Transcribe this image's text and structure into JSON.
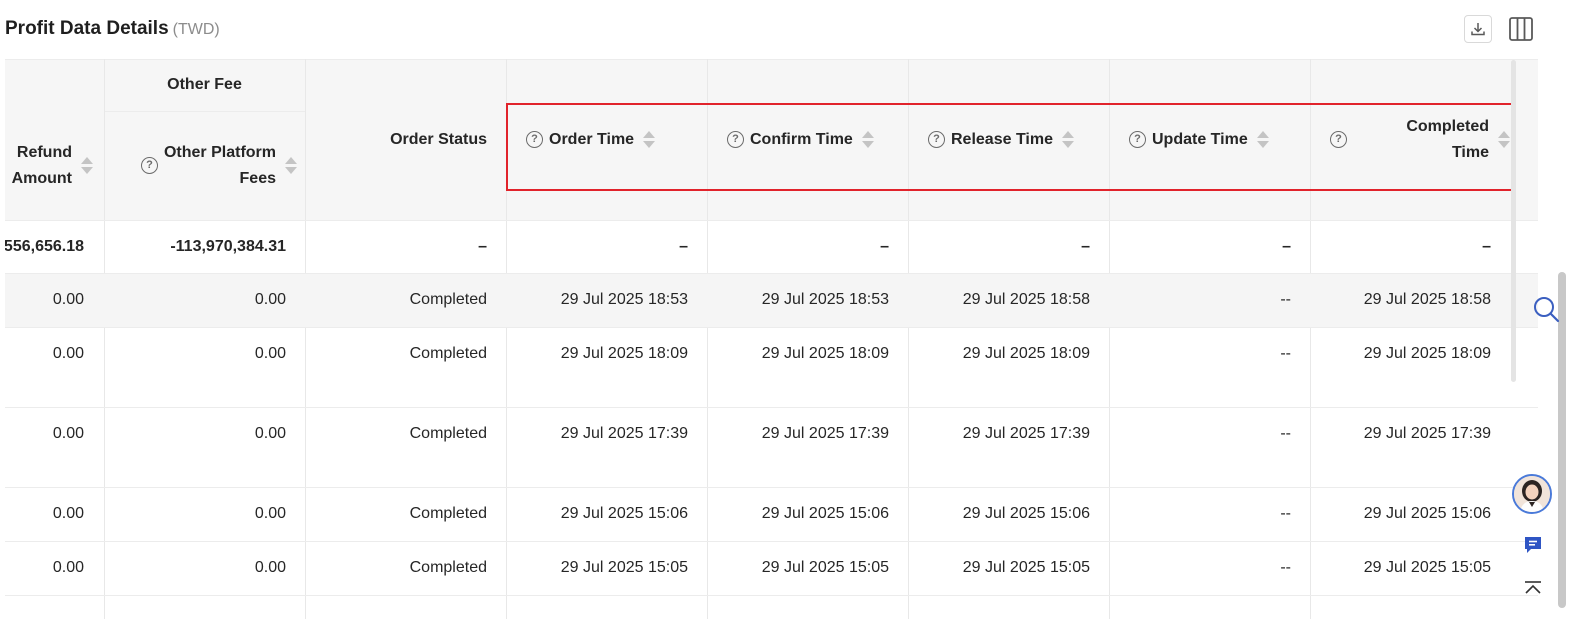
{
  "header": {
    "title": "Profit Data Details",
    "currency": "(TWD)"
  },
  "toolbar": {
    "download_icon": "download-icon",
    "columns_icon": "columns-settings-icon"
  },
  "table": {
    "group_header": "Other Fee",
    "columns": {
      "refund_amount": [
        "Refund",
        "Amount"
      ],
      "other_platform_fees": [
        "Other Platform",
        "Fees"
      ],
      "order_status": "Order Status",
      "order_time": "Order Time",
      "confirm_time": "Confirm Time",
      "release_time": "Release Time",
      "update_time": "Update Time",
      "completed_time": [
        "Completed",
        "Time"
      ]
    },
    "total_row": {
      "refund_amount": "556,656.18",
      "other_platform_fees": "-113,970,384.31",
      "order_status": "–",
      "order_time": "–",
      "confirm_time": "–",
      "release_time": "–",
      "update_time": "–",
      "completed_time": "–"
    },
    "rows": [
      {
        "refund_amount": "0.00",
        "other_platform_fees": "0.00",
        "order_status": "Completed",
        "order_time": "29 Jul 2025 18:53",
        "confirm_time": "29 Jul 2025 18:53",
        "release_time": "29 Jul 2025 18:58",
        "update_time": "--",
        "completed_time": "29 Jul 2025 18:58"
      },
      {
        "refund_amount": "0.00",
        "other_platform_fees": "0.00",
        "order_status": "Completed",
        "order_time": "29 Jul 2025 18:09",
        "confirm_time": "29 Jul 2025 18:09",
        "release_time": "29 Jul 2025 18:09",
        "update_time": "--",
        "completed_time": "29 Jul 2025 18:09"
      },
      {
        "refund_amount": "0.00",
        "other_platform_fees": "0.00",
        "order_status": "Completed",
        "order_time": "29 Jul 2025 17:39",
        "confirm_time": "29 Jul 2025 17:39",
        "release_time": "29 Jul 2025 17:39",
        "update_time": "--",
        "completed_time": "29 Jul 2025 17:39"
      },
      {
        "refund_amount": "0.00",
        "other_platform_fees": "0.00",
        "order_status": "Completed",
        "order_time": "29 Jul 2025 15:06",
        "confirm_time": "29 Jul 2025 15:06",
        "release_time": "29 Jul 2025 15:06",
        "update_time": "--",
        "completed_time": "29 Jul 2025 15:06"
      },
      {
        "refund_amount": "0.00",
        "other_platform_fees": "0.00",
        "order_status": "Completed",
        "order_time": "29 Jul 2025 15:05",
        "confirm_time": "29 Jul 2025 15:05",
        "release_time": "29 Jul 2025 15:05",
        "update_time": "--",
        "completed_time": "29 Jul 2025 15:05"
      }
    ]
  },
  "highlight_color": "#e1232b",
  "sidebar": {
    "search_icon": "search-icon",
    "avatar_icon": "support-avatar-icon",
    "chat_icon": "chat-icon",
    "top_icon": "back-to-top-icon"
  }
}
